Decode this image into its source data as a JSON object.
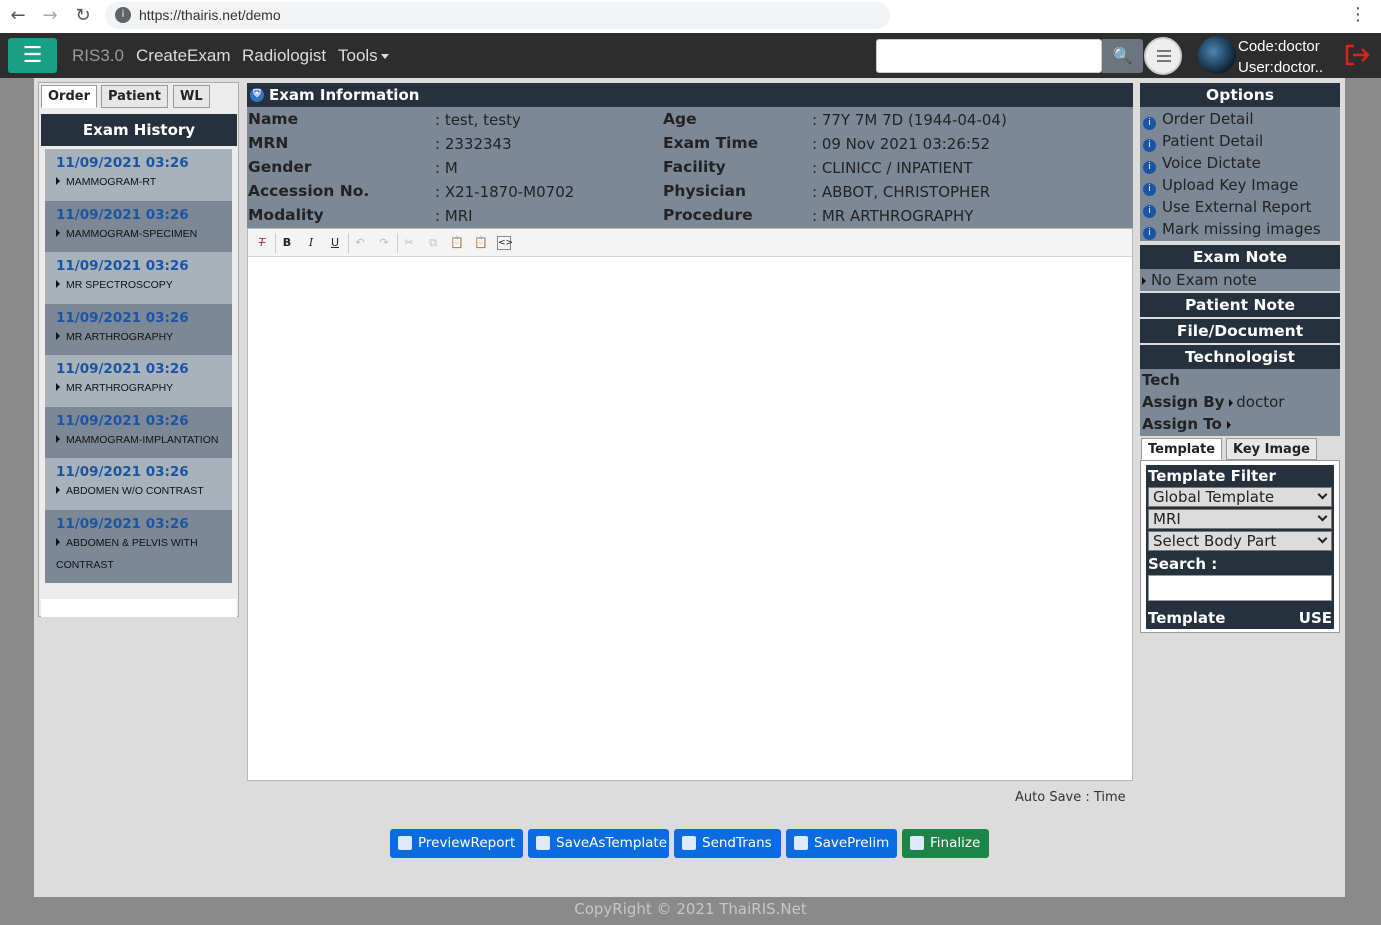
{
  "browser": {
    "url": "https://thairis.net/demo"
  },
  "navbar": {
    "brand": "RIS3.0",
    "links": [
      "CreateExam",
      "Radiologist",
      "Tools"
    ],
    "code": "Code:doctor",
    "user": "User:doctor..",
    "search_placeholder": ""
  },
  "left_panel": {
    "tabs": [
      "Order",
      "Patient",
      "WL"
    ],
    "active_tab": "Order",
    "history_title": "Exam History",
    "history": [
      {
        "date": "11/09/2021 03:26",
        "procedure": "MAMMOGRAM-RT"
      },
      {
        "date": "11/09/2021 03:26",
        "procedure": "MAMMOGRAM-SPECIMEN"
      },
      {
        "date": "11/09/2021 03:26",
        "procedure": "MR SPECTROSCOPY"
      },
      {
        "date": "11/09/2021 03:26",
        "procedure": "MR ARTHROGRAPHY"
      },
      {
        "date": "11/09/2021 03:26",
        "procedure": "MR ARTHROGRAPHY"
      },
      {
        "date": "11/09/2021 03:26",
        "procedure": "MAMMOGRAM-IMPLANTATION"
      },
      {
        "date": "11/09/2021 03:26",
        "procedure": "ABDOMEN W/O CONTRAST"
      },
      {
        "date": "11/09/2021 03:26",
        "procedure": "ABDOMEN & PELVIS WITH CONTRAST"
      }
    ]
  },
  "exam_info": {
    "title": "Exam Information",
    "fields_left": [
      {
        "label": "Name",
        "value": ": test, testy"
      },
      {
        "label": "MRN",
        "value": ": 2332343"
      },
      {
        "label": "Gender",
        "value": ": M"
      },
      {
        "label": "Accession No.",
        "value": ": X21-1870-M0702"
      },
      {
        "label": "Modality",
        "value": ": MRI"
      }
    ],
    "fields_right": [
      {
        "label": "Age",
        "value": ": 77Y 7M 7D (1944-04-04)"
      },
      {
        "label": "Exam Time",
        "value": ": 09 Nov 2021 03:26:52"
      },
      {
        "label": "Facility",
        "value": ": CLINICC / INPATIENT"
      },
      {
        "label": "Physician",
        "value": ": ABBOT, CHRISTOPHER"
      },
      {
        "label": "Procedure",
        "value": ": MR ARTHROGRAPHY"
      }
    ]
  },
  "editor": {
    "toolbar_icons": [
      "remove-format-icon",
      "bold-icon",
      "italic-icon",
      "underline-icon",
      "undo-icon",
      "redo-icon",
      "cut-icon",
      "copy-icon",
      "paste-icon",
      "paste-word-icon",
      "source-icon"
    ],
    "autosave": "Auto Save : Time"
  },
  "actions": {
    "preview": "PreviewReport",
    "save_template": "SaveAsTemplate",
    "send_trans": "SendTrans",
    "save_prelim": "SavePrelim",
    "finalize": "Finalize"
  },
  "options": {
    "title": "Options",
    "items": [
      "Order Detail",
      "Patient Detail",
      "Voice Dictate",
      "Upload Key Image",
      "Use External Report",
      "Mark missing images"
    ]
  },
  "exam_note": {
    "title": "Exam Note",
    "text": "No Exam note"
  },
  "patient_note": {
    "title": "Patient Note"
  },
  "file_document": {
    "title": "File/Document"
  },
  "technologist": {
    "title": "Technologist",
    "tech_label": "Tech",
    "assign_by_label": "Assign By",
    "assign_by_value": "doctor",
    "assign_to_label": "Assign To",
    "assign_to_value": ""
  },
  "template_panel": {
    "tabs": [
      "Template",
      "Key Image"
    ],
    "active_tab": "Template",
    "filter_title": "Template Filter",
    "selects": [
      "Global Template",
      "MRI",
      "Select Body Part"
    ],
    "search_label": "Search :",
    "search_value": "",
    "col_template": "Template",
    "col_use": "USE"
  },
  "footer": "CopyRight © 2021 ThaiRIS.Net",
  "colors": {
    "dark_header": "#25313d",
    "panel_gray": "#7c8896",
    "teal": "#1a9e85",
    "blue_button": "#0b6be0",
    "green_button": "#1d8447"
  }
}
